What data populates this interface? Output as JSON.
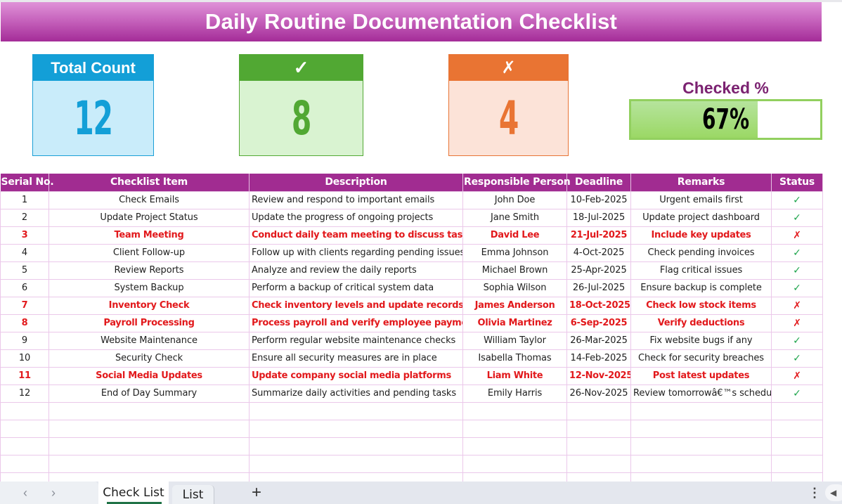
{
  "title": "Daily Routine Documentation Checklist",
  "cards": {
    "total": {
      "label": "Total Count",
      "value": "12"
    },
    "checked": {
      "label": "✓",
      "value": "8"
    },
    "unchecked": {
      "label": "✗",
      "value": "4"
    }
  },
  "progress": {
    "label": "Checked %",
    "value_text": "67%",
    "fraction": 0.67
  },
  "table": {
    "columns": [
      "Serial No.",
      "Checklist Item",
      "Description",
      "Responsible Person",
      "Deadline",
      "Remarks",
      "Status"
    ],
    "rows": [
      {
        "serial": "1",
        "item": "Check Emails",
        "description": "Review and respond to important emails",
        "person": "John Doe",
        "deadline": "10-Feb-2025",
        "remarks": "Urgent emails first",
        "status": "✓",
        "done": true
      },
      {
        "serial": "2",
        "item": "Update Project Status",
        "description": "Update the progress of ongoing projects",
        "person": "Jane Smith",
        "deadline": "18-Jul-2025",
        "remarks": "Update project dashboard",
        "status": "✓",
        "done": true
      },
      {
        "serial": "3",
        "item": "Team Meeting",
        "description": "Conduct daily team meeting to discuss tasks",
        "person": "David Lee",
        "deadline": "21-Jul-2025",
        "remarks": "Include key updates",
        "status": "✗",
        "done": false
      },
      {
        "serial": "4",
        "item": "Client Follow-up",
        "description": "Follow up with clients regarding pending issues",
        "person": "Emma Johnson",
        "deadline": "4-Oct-2025",
        "remarks": "Check pending invoices",
        "status": "✓",
        "done": true
      },
      {
        "serial": "5",
        "item": "Review Reports",
        "description": "Analyze and review the daily reports",
        "person": "Michael Brown",
        "deadline": "25-Apr-2025",
        "remarks": "Flag critical issues",
        "status": "✓",
        "done": true
      },
      {
        "serial": "6",
        "item": "System Backup",
        "description": "Perform a backup of critical system data",
        "person": "Sophia Wilson",
        "deadline": "26-Jul-2025",
        "remarks": "Ensure backup is complete",
        "status": "✓",
        "done": true
      },
      {
        "serial": "7",
        "item": "Inventory Check",
        "description": "Check inventory levels and update records",
        "person": "James Anderson",
        "deadline": "18-Oct-2025",
        "remarks": "Check low stock items",
        "status": "✗",
        "done": false
      },
      {
        "serial": "8",
        "item": "Payroll Processing",
        "description": "Process payroll and verify employee payments",
        "person": "Olivia Martinez",
        "deadline": "6-Sep-2025",
        "remarks": "Verify deductions",
        "status": "✗",
        "done": false
      },
      {
        "serial": "9",
        "item": "Website Maintenance",
        "description": "Perform regular website maintenance checks",
        "person": "William Taylor",
        "deadline": "26-Mar-2025",
        "remarks": "Fix website bugs if any",
        "status": "✓",
        "done": true
      },
      {
        "serial": "10",
        "item": "Security Check",
        "description": "Ensure all security measures are in place",
        "person": "Isabella Thomas",
        "deadline": "14-Feb-2025",
        "remarks": "Check for security breaches",
        "status": "✓",
        "done": true
      },
      {
        "serial": "11",
        "item": "Social Media Updates",
        "description": "Update company social media platforms",
        "person": "Liam White",
        "deadline": "12-Nov-2025",
        "remarks": "Post latest updates",
        "status": "✗",
        "done": false
      },
      {
        "serial": "12",
        "item": "End of Day Summary",
        "description": "Summarize daily activities and pending tasks",
        "person": "Emily Harris",
        "deadline": "26-Nov-2025",
        "remarks": "Review tomorrowâ€™s schedule",
        "status": "✓",
        "done": true
      }
    ],
    "empty_rows": 5
  },
  "sheet_tabs": {
    "prev_icon": "‹",
    "next_icon": "›",
    "tabs": [
      "Check List",
      "List"
    ],
    "active": "Check List",
    "add_icon": "+",
    "more_icon": "⋮",
    "scroll_icon": "◀"
  },
  "colors": {
    "banner": "#a42c98",
    "header": "#a12c91",
    "total": "#139fd7",
    "checked": "#51a833",
    "unchecked": "#e97433",
    "pending_text": "#e2191c",
    "done_status": "#1ea54c",
    "progress_fill": "#9bd865"
  }
}
